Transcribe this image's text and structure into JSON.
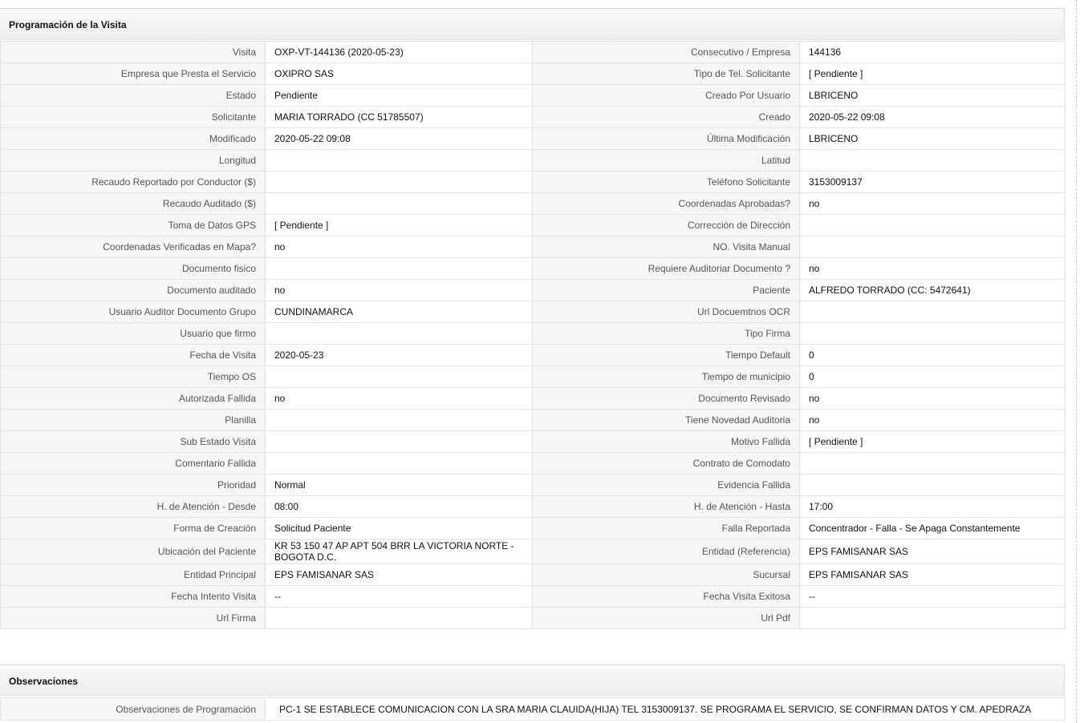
{
  "section1_title": "Programación de la Visita",
  "section2_title": "Observaciones",
  "rows": [
    {
      "l1": "Visita",
      "v1": "OXP-VT-144136 (2020-05-23)",
      "l2": "Consecutivo / Empresa",
      "v2": "144136"
    },
    {
      "l1": "Empresa que Presta el Servicio",
      "v1": "OXIPRO SAS",
      "l2": "Tipo de Tel. Solicitante",
      "v2": "[ Pendiente ]"
    },
    {
      "l1": "Estado",
      "v1": "Pendiente",
      "l2": "Creado Por Usuario",
      "v2": "LBRICENO"
    },
    {
      "l1": "Solicitante",
      "v1": "MARIA TORRADO (CC 51785507)",
      "l2": "Creado",
      "v2": "2020-05-22 09:08"
    },
    {
      "l1": "Modificado",
      "v1": "2020-05-22 09:08",
      "l2": "Última Modificación",
      "v2": " LBRICENO"
    },
    {
      "l1": "Longitud",
      "v1": "",
      "l2": "Latitud",
      "v2": ""
    },
    {
      "l1": "Recaudo Reportado por Conductor ($)",
      "v1": "",
      "l2": "Teléfono Solicitante",
      "v2": "3153009137"
    },
    {
      "l1": "Recaudo Auditado ($)",
      "v1": "",
      "l2": "Coordenadas Aprobadas?",
      "v2": " no"
    },
    {
      "l1": "Toma de Datos GPS",
      "v1": "[ Pendiente ]",
      "l2": "Corrección de Dirección",
      "v2": ""
    },
    {
      "l1": "Coordenadas Verificadas en Mapa?",
      "v1": " no",
      "l2": "NO. Visita Manual",
      "v2": ""
    },
    {
      "l1": "Documento fisico",
      "v1": "",
      "l2": "Requiere Auditoriar Documento ?",
      "v2": " no"
    },
    {
      "l1": "Documento auditado",
      "v1": " no",
      "l2": "Paciente",
      "v2": "ALFREDO TORRADO (CC: 5472641)"
    },
    {
      "l1": "Usuario Auditor Documento Grupo",
      "v1": "CUNDINAMARCA",
      "l2": "Url Docuemtnos OCR",
      "v2": ""
    },
    {
      "l1": "Usuario que firmo",
      "v1": "",
      "l2": "Tipo Firma",
      "v2": ""
    },
    {
      "l1": "Fecha de Visita",
      "v1": " 2020-05-23",
      "l2": "Tiempo Default",
      "v2": "0"
    },
    {
      "l1": "Tiempo OS",
      "v1": "",
      "l2": "Tiempo de municipio",
      "v2": "0"
    },
    {
      "l1": "Autorizada Fallida",
      "v1": " no",
      "l2": "Documento Revisado",
      "v2": " no"
    },
    {
      "l1": "Planilla",
      "v1": "",
      "l2": "Tiene Novedad Auditoria",
      "v2": " no"
    },
    {
      "l1": "Sub Estado Visita",
      "v1": "",
      "l2": "Motivo Fallida",
      "v2": "[ Pendiente ]"
    },
    {
      "l1": "Comentario Fallida",
      "v1": "",
      "l2": "Contrato de Comodato",
      "v2": ""
    },
    {
      "l1": "Prioridad",
      "v1": "Normal",
      "l2": "Evidencia Fallida",
      "v2": ""
    },
    {
      "l1": "H. de Atención - Desde",
      "v1": "08:00",
      "l2": "H. de Atención - Hasta",
      "v2": "17:00"
    },
    {
      "l1": "Forma de Creación",
      "v1": "Solicitud Paciente",
      "l2": "Falla Reportada",
      "v2": "Concentrador - Falla - Se Apaga Constantemente"
    },
    {
      "l1": "Ubicación del Paciente",
      "v1": "KR 53 150 47 AP APT 504 BRR LA VICTORIA NORTE - BOGOTA D.C.",
      "l2": "Entidad (Referencia)",
      "v2": "EPS FAMISANAR SAS"
    },
    {
      "l1": "Entidad Principal",
      "v1": "EPS FAMISANAR SAS",
      "l2": "Sucursal",
      "v2": "EPS FAMISANAR SAS"
    },
    {
      "l1": "Fecha Intento Visita",
      "v1": " --",
      "l2": "Fecha Visita Exitosa",
      "v2": " --"
    },
    {
      "l1": "Url Firma",
      "v1": "",
      "l2": "Url Pdf",
      "v2": ""
    }
  ],
  "observaciones": {
    "label": "Observaciones de Programación",
    "value": "PC-1 SE ESTABLECE COMUNICACION CON LA SRA MARIA CLAUIDA(HIJA) TEL 3153009137. SE PROGRAMA EL SERVICIO, SE CONFIRMAN DATOS Y CM. APEDRAZA"
  }
}
